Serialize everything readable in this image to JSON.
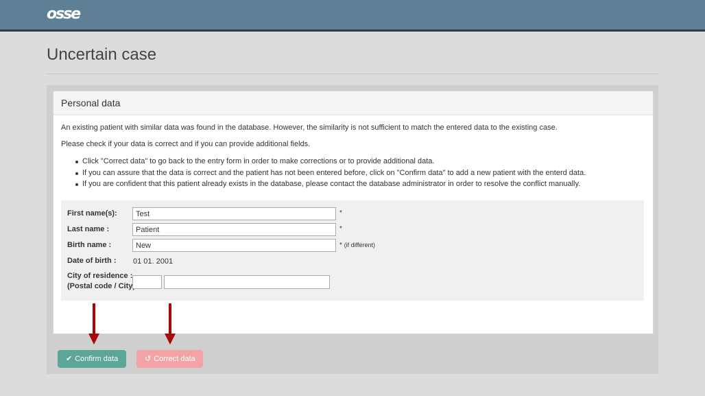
{
  "app": {
    "logo_text": "osse"
  },
  "page": {
    "title": "Uncertain case"
  },
  "card": {
    "title": "Personal data",
    "intro_1": "An existing patient with similar data was found in the database. However, the similarity is not sufficient to match the entered data to the existing case.",
    "intro_2": "Please check if your data is correct and if you can provide additional fields.",
    "bullets": [
      "Click \"Correct data\" to go back to the entry form in order to make corrections or to provide additional data.",
      "If you can assure that the data is correct and the patient has not been entered before, click on \"Confirm data\" to add a new patient with the enterd data.",
      "If you are confident that this patient already exists in the database, please contact the database administrator in order to resolve the conflict manually."
    ]
  },
  "form": {
    "first_name": {
      "label": "First name(s):",
      "value": "Test",
      "required_mark": "*"
    },
    "last_name": {
      "label": "Last name :",
      "value": "Patient",
      "required_mark": "*"
    },
    "birth_name": {
      "label": "Birth name :",
      "value": "New",
      "required_mark": "*",
      "hint": "(if different)"
    },
    "date_of_birth": {
      "label": "Date of birth :",
      "value": "01 01. 2001"
    },
    "residence": {
      "label_line1": "City of residence :",
      "label_line2": "(Postal code / City)",
      "postal_value": "",
      "city_value": ""
    }
  },
  "buttons": {
    "confirm": {
      "label": "Confirm data",
      "icon": "check-icon",
      "color": "#5da597"
    },
    "correct": {
      "label": "Correct data",
      "icon": "undo-icon",
      "color": "#f4a3a4"
    }
  },
  "annotations": {
    "arrow_color": "#a50a0a"
  }
}
